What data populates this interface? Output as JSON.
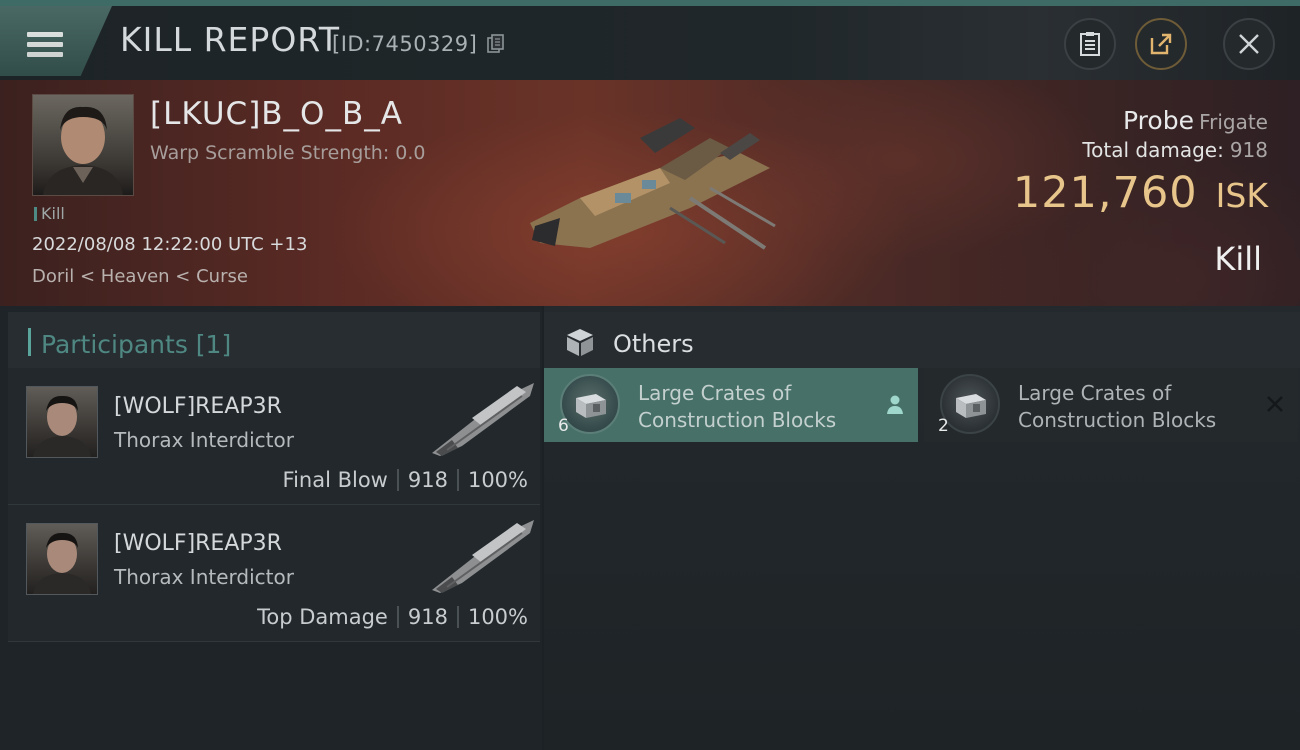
{
  "header": {
    "title": "KILL REPORT",
    "report_id": "[ID:7450329]",
    "icons": [
      "menu-icon",
      "copy-icon",
      "clipboard-icon",
      "share-icon",
      "close-icon"
    ]
  },
  "victim": {
    "name": "[LKUC]B_O_B_A",
    "scramble": "Warp Scramble Strength: 0.0",
    "tag": "Kill",
    "datetime": "2022/08/08 12:22:00 UTC +13",
    "location": "Doril < Heaven < Curse",
    "ship_name": "Probe",
    "ship_class": "Frigate",
    "damage_label": "Total damage:",
    "damage_value": "918",
    "isk_value": "121,760",
    "isk_unit": "ISK",
    "result": "Kill"
  },
  "participants": {
    "header": "Participants [1]",
    "rows": [
      {
        "name": "[WOLF]REAP3R",
        "ship": "Thorax Interdictor",
        "role": "Final Blow",
        "damage": "918",
        "percent": "100%"
      },
      {
        "name": "[WOLF]REAP3R",
        "ship": "Thorax Interdictor",
        "role": "Top Damage",
        "damage": "918",
        "percent": "100%"
      }
    ]
  },
  "others": {
    "header": "Others",
    "items": [
      {
        "name": "Large Crates of Construction Blocks",
        "qty": "6",
        "status_icon": "person-icon"
      },
      {
        "name": "Large Crates of Construction Blocks",
        "qty": "2",
        "status_icon": "destroyed-x-icon"
      }
    ]
  },
  "colors": {
    "accent": "#477068",
    "isk": "#e8c58a",
    "participants_header": "#4f8882"
  }
}
